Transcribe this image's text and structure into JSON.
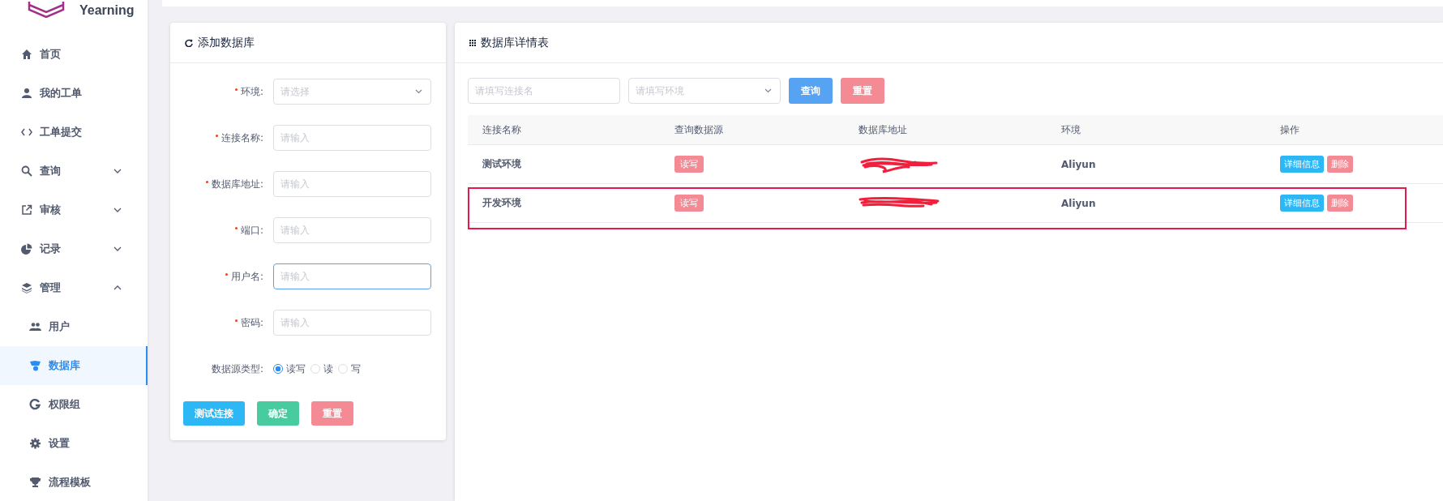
{
  "logo": {
    "text": "Yearning"
  },
  "sidebar": {
    "items": [
      {
        "label": "首页",
        "selected": false
      },
      {
        "label": "我的工单",
        "selected": false
      },
      {
        "label": "工单提交",
        "selected": false
      },
      {
        "label": "查询",
        "selected": false,
        "expanded": false
      },
      {
        "label": "审核",
        "selected": false,
        "expanded": false
      },
      {
        "label": "记录",
        "selected": false,
        "expanded": false
      },
      {
        "label": "管理",
        "selected": false,
        "expanded": true,
        "children": [
          {
            "label": "用户",
            "selected": false
          },
          {
            "label": "数据库",
            "selected": true
          },
          {
            "label": "权限组",
            "selected": false
          },
          {
            "label": "设置",
            "selected": false
          },
          {
            "label": "流程模板",
            "selected": false
          }
        ]
      }
    ]
  },
  "form_card": {
    "title": "添加数据库",
    "fields": [
      {
        "kind": "select",
        "label": "环境:",
        "required": true,
        "placeholder": "请选择",
        "focused": false
      },
      {
        "kind": "input",
        "label": "连接名称:",
        "required": true,
        "placeholder": "请输入",
        "focused": false
      },
      {
        "kind": "input",
        "label": "数据库地址:",
        "required": true,
        "placeholder": "请输入",
        "focused": false
      },
      {
        "kind": "input",
        "label": "端口:",
        "required": true,
        "placeholder": "请输入",
        "focused": false
      },
      {
        "kind": "input",
        "label": "用户名:",
        "required": true,
        "placeholder": "请输入",
        "focused": true
      },
      {
        "kind": "input",
        "label": "密码:",
        "required": true,
        "placeholder": "请输入",
        "focused": false
      }
    ],
    "source_type": {
      "label": "数据源类型:",
      "options": [
        {
          "label": "读写",
          "selected": true
        },
        {
          "label": "读",
          "selected": false
        },
        {
          "label": "写",
          "selected": false
        }
      ]
    },
    "buttons": [
      {
        "label": "测试连接",
        "kind": "info"
      },
      {
        "label": "确定",
        "kind": "success"
      },
      {
        "label": "重置",
        "kind": "danger"
      }
    ]
  },
  "table_card": {
    "title": "数据库详情表",
    "filters": [
      {
        "kind": "input",
        "placeholder": "请填写连接名"
      },
      {
        "kind": "select",
        "placeholder": "请填写环境"
      }
    ],
    "buttons": [
      {
        "label": "查询",
        "kind": "primary"
      },
      {
        "label": "重置",
        "kind": "danger"
      }
    ],
    "table": {
      "columns": [
        "连接名称",
        "查询数据源",
        "数据库地址",
        "环境",
        "操作"
      ],
      "rows": [
        {
          "name": "测试环境",
          "source": "读写",
          "address_redacted": true,
          "env": "Aliyun",
          "actions": [
            "详细信息",
            "删除"
          ],
          "highlighted": false
        },
        {
          "name": "开发环境",
          "source": "读写",
          "address_redacted": true,
          "env": "Aliyun",
          "actions": [
            "详细信息",
            "删除"
          ],
          "highlighted": true
        }
      ]
    }
  }
}
